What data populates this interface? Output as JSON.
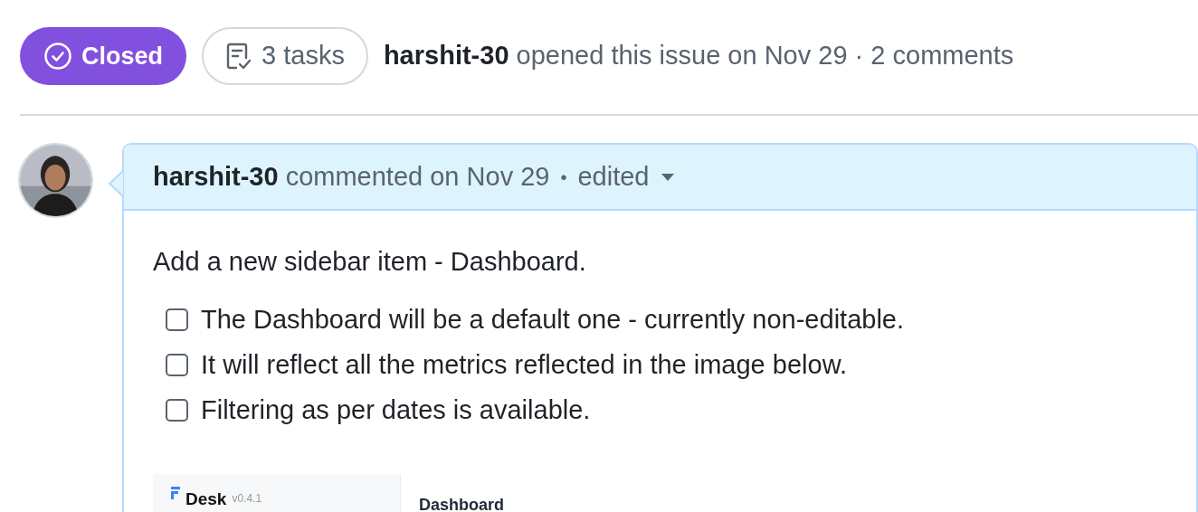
{
  "issue": {
    "state": {
      "label": "Closed",
      "kind": "closed"
    },
    "tasks": "3 tasks",
    "author": "harshit-30",
    "summary": "opened this issue on Nov 29 · 2 comments"
  },
  "comment": {
    "author": "harshit-30",
    "meta": "commented on Nov 29",
    "separator": "•",
    "edited": "edited",
    "body": "Add a new sidebar item - Dashboard.",
    "tasks": [
      {
        "label": "The Dashboard will be a default one - currently non-editable.",
        "checked": false
      },
      {
        "label": "It will reflect all the metrics reflected in the image below.",
        "checked": false
      },
      {
        "label": "Filtering as per dates is available.",
        "checked": false
      }
    ],
    "embedded_screenshot": {
      "app_name": "Desk",
      "version": "v0.4.1",
      "page_title": "Dashboard"
    }
  }
}
